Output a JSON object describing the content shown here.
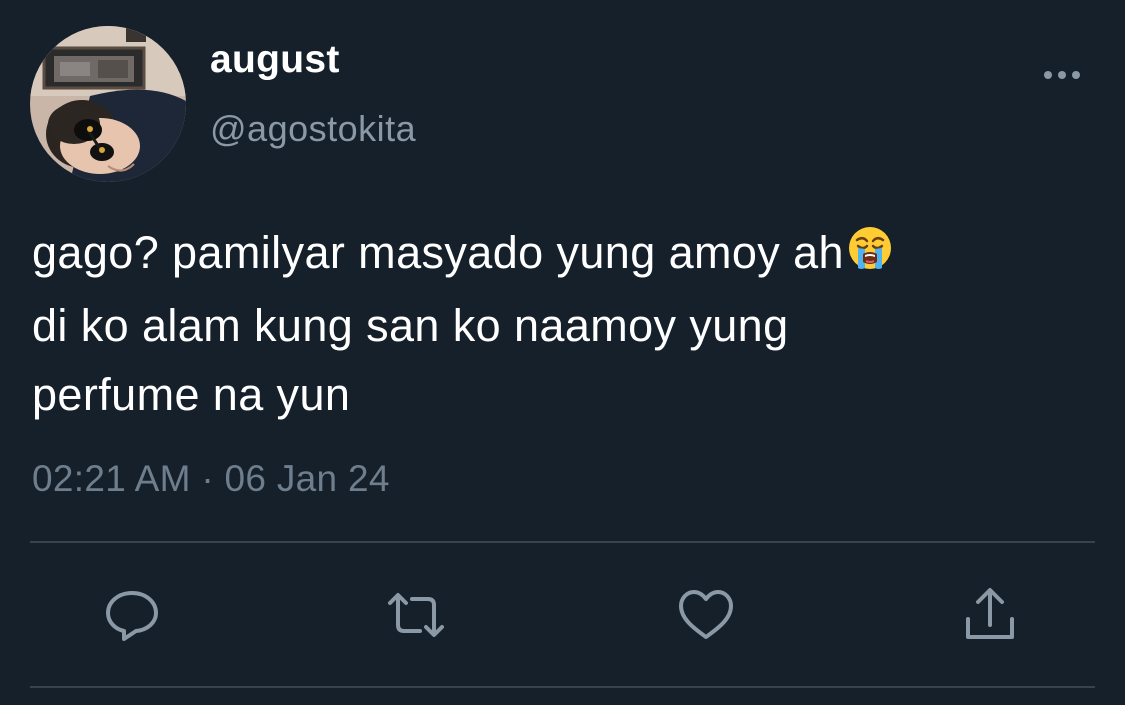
{
  "author": {
    "display_name": "august",
    "handle": "@agostokita"
  },
  "tweet": {
    "lines": [
      "gago? pamilyar masyado yung amoy ah",
      "di ko alam kung san ko naamoy yung",
      "perfume na yun"
    ],
    "emoji": "loudly-crying-face-emoji",
    "time": "02:21 AM",
    "separator": "·",
    "date": "06 Jan 24"
  },
  "icons": {
    "more": "more-horizontal-icon",
    "reply": "reply-icon",
    "retweet": "retweet-icon",
    "like": "like-icon",
    "share": "share-icon"
  },
  "colors": {
    "background": "#15202b",
    "primary_text": "#ffffff",
    "secondary_text": "#8b98a5",
    "icon": "#8b98a5",
    "divider": "#38444d"
  }
}
